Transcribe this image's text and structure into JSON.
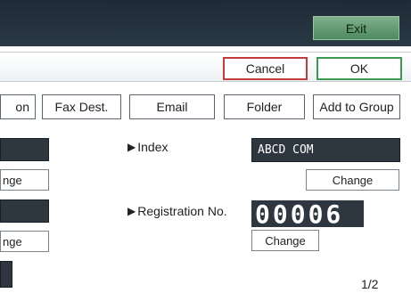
{
  "header": {
    "exit_label": "Exit"
  },
  "actions": {
    "cancel_label": "Cancel",
    "ok_label": "OK"
  },
  "tabs": [
    {
      "label": "on"
    },
    {
      "label": "Fax Dest."
    },
    {
      "label": "Email"
    },
    {
      "label": "Folder"
    },
    {
      "label": "Add to Group"
    }
  ],
  "left_column": {
    "change_partial_1": "nge",
    "change_partial_2": "nge"
  },
  "index": {
    "label": "Index",
    "value": "ABCD COM",
    "change_label": "Change"
  },
  "registration": {
    "label": "Registration No.",
    "value": "00006",
    "change_label": "Change"
  },
  "pagination": {
    "text": "1/2"
  },
  "colors": {
    "cancel_border": "#c43b3b",
    "ok_border": "#3a9a4f",
    "exit_bg": "#5e9a6e",
    "dark_field": "#2e3640"
  }
}
